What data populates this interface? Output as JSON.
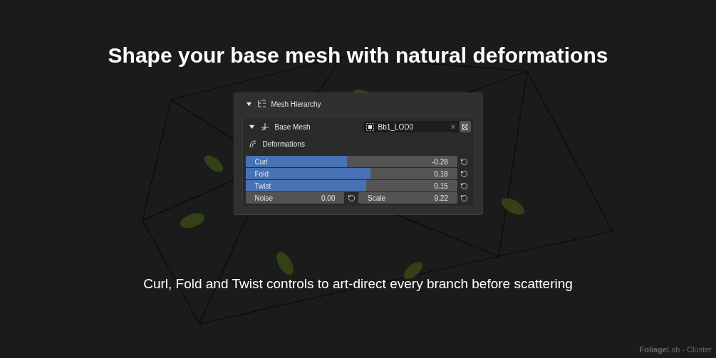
{
  "title": "Shape your base mesh with natural deformations",
  "panel": {
    "title": "Mesh Hierarchy",
    "expanded": true,
    "base_mesh": {
      "label": "Base Mesh",
      "expanded": true,
      "value": "Bb1_LOD0"
    },
    "section": "Deformations",
    "sliders": [
      {
        "label": "Curl",
        "reading": "-0.28",
        "level": 0.48
      },
      {
        "label": "Fold",
        "reading": "0.18",
        "level": 0.59
      },
      {
        "label": "Twist",
        "reading": "0.15",
        "level": 0.57
      }
    ],
    "fields": [
      {
        "label": "Noise",
        "reading": "0.00"
      },
      {
        "label": "Scale",
        "reading": "9.22"
      }
    ]
  },
  "subtitle": "Curl, Fold and Twist controls to art-direct every branch before scattering",
  "footer": "**Foliage**Lab - Cluster"
}
